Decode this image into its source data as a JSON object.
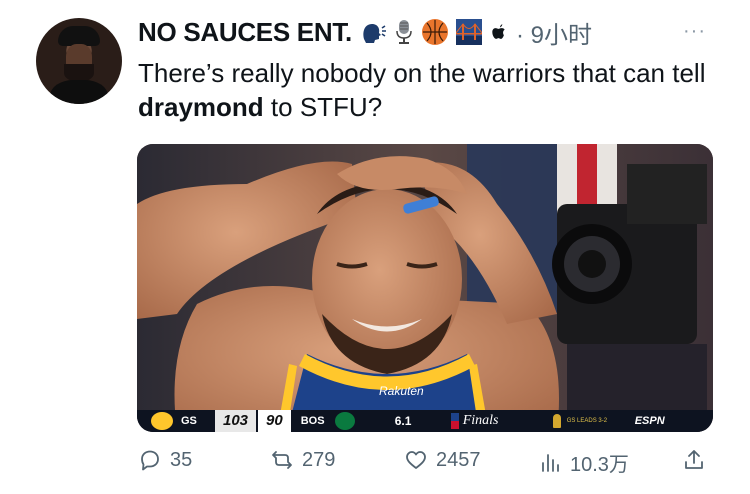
{
  "tweet": {
    "author_name": "NO SAUCES ENT.",
    "time": "· 9小时",
    "more_label": "···",
    "text_before": "There’s really nobody on the warriors that can tell ",
    "text_bold": "draymond",
    "text_after": " to STFU?"
  },
  "scorebug": {
    "team_home": "GS",
    "score_home": "103",
    "score_away": "90",
    "team_away": "BOS",
    "clock": "6.1",
    "finals_label": "Finals",
    "series_text": "GS LEADS 3-2",
    "network": "ESPN",
    "jersey_sponsor": "Rakuten"
  },
  "actions": {
    "replies": "35",
    "retweets": "279",
    "likes": "2457",
    "views": "10.3万"
  },
  "colors": {
    "accent_gray": "#536471",
    "text": "#0f1419",
    "warriors_blue": "#1d428a",
    "warriors_gold": "#ffc72c"
  }
}
